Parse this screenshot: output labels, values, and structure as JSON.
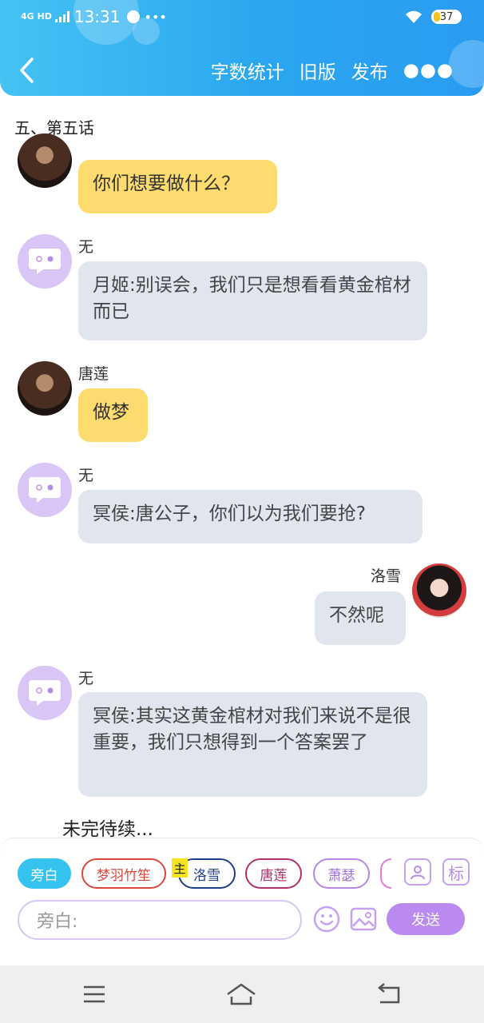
{
  "status_bar": {
    "network": "4G HD",
    "time": "13:31",
    "battery": "37"
  },
  "nav": {
    "action_word_count": "字数统计",
    "action_old_version": "旧版",
    "action_publish": "发布"
  },
  "chapter_title": "五、第五话",
  "messages": [
    {
      "speaker": "",
      "text": "你们想要做什么？"
    },
    {
      "speaker": "无",
      "text": "月姬:别误会，我们只是想看看黄金棺材而已"
    },
    {
      "speaker": "唐莲",
      "text": "做梦"
    },
    {
      "speaker": "无",
      "text": "冥侯:唐公子，你们以为我们要抢?"
    },
    {
      "speaker": "洛雪",
      "text": "不然呢"
    },
    {
      "speaker": "无",
      "text": "冥侯:其实这黄金棺材对我们来说不是很重要，我们只想得到一个答案罢了"
    }
  ],
  "to_be_continued": "未完待续...",
  "characters": [
    "旁白",
    "梦羽竹笙",
    "洛雪",
    "唐莲",
    "萧瑟"
  ],
  "main_tag": "主",
  "mark_button": "标",
  "input": {
    "placeholder": "旁白:"
  },
  "send_label": "发送",
  "colors": {
    "header": "#2aa6f0",
    "narrator_chip": "#36c2ef",
    "send": "#bb8af0",
    "yellow_bubble": "#fddb6e",
    "gray_bubble": "#e1e5ee"
  }
}
